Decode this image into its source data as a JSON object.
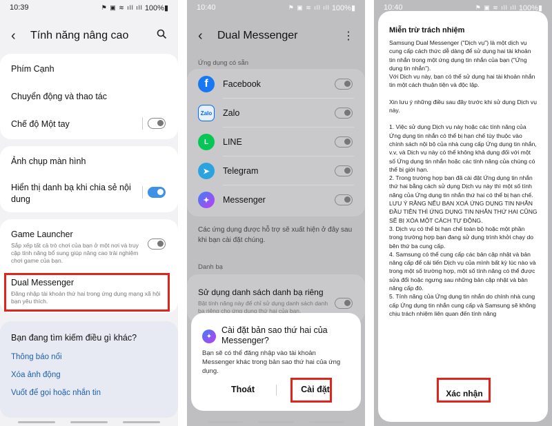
{
  "screen1": {
    "time": "10:39",
    "status_icons": "⚑ ▣ ≋ ıll ıll",
    "battery": "100%▮",
    "title": "Tính năng nâng cao",
    "items_card1": [
      "Phím Cạnh",
      "Chuyển động và thao tác",
      "Chế độ Một tay"
    ],
    "items_card2": [
      "Ảnh chụp màn hình",
      "Hiển thị danh bạ khi chia sẻ nội dung"
    ],
    "game_launcher": {
      "title": "Game Launcher",
      "sub": "Sắp xếp tất cả trò chơi của bạn ở một nơi và truy cập tính năng bổ sung giúp nâng cao trải nghiệm chơi game của bạn."
    },
    "dual_messenger": {
      "title": "Dual Messenger",
      "sub": "Đăng nhập tài khoản thứ hai trong ứng dụng mạng xã hội bạn yêu thích."
    },
    "search_prompt": "Bạn đang tìm kiếm điều gì khác?",
    "links": [
      "Thông báo nổi",
      "Xóa ảnh động",
      "Vuốt để gọi hoặc nhắn tin"
    ]
  },
  "screen2": {
    "time": "10:40",
    "status_icons": "⚑ ▣ ≋ ıll ıll",
    "battery": "100%▮",
    "title": "Dual Messenger",
    "section_available": "Ứng dụng có sẵn",
    "apps": [
      {
        "name": "Facebook",
        "icon": "f",
        "color": "#1877f2"
      },
      {
        "name": "Zalo",
        "icon": "Zalo",
        "color": "#0068ff"
      },
      {
        "name": "LINE",
        "icon": "L",
        "color": "#06c755"
      },
      {
        "name": "Telegram",
        "icon": "➤",
        "color": "#2aa3df"
      },
      {
        "name": "Messenger",
        "icon": "✦",
        "color": "#a23bec"
      }
    ],
    "note": "Các ứng dụng được hỗ trợ sẽ xuất hiện ở đây sau khi bạn cài đặt chúng.",
    "section_contacts": "Danh bạ",
    "contacts_title": "Sử dụng danh sách danh bạ riêng",
    "contacts_sub": "Bật tính năng này để chỉ sử dụng danh sách danh bạ riêng cho ứng dụng thứ hai của bạn.",
    "dialog": {
      "title": "Cài đặt bản sao thứ hai của Messenger?",
      "body": "Bạn sẽ có thể đăng nhập vào tài khoản Messenger khác trong bản sao thứ hai của ứng dụng.",
      "cancel": "Thoát",
      "confirm": "Cài đặt"
    }
  },
  "screen3": {
    "time": "10:40",
    "status_icons": "⚑ ▣ ≋ ıll ıll",
    "battery": "100%▮",
    "heading": "Miễn trừ trách nhiệm",
    "paragraphs": [
      "Samsung Dual Messenger (\"Dịch vụ\") là một dịch vụ cung cấp cách thức dễ dàng để sử dụng hai tài khoản tin nhắn trong một ứng dụng tin nhắn của bạn (\"Ứng dụng tin nhắn\").",
      "Với Dịch vụ này, bạn có thể sử dụng hai tài khoản nhắn tin một cách thuận tiện và độc lập.",
      "Xin lưu ý những điều sau đây trước khi sử dụng Dịch vụ này.",
      "1. Việc sử dụng Dịch vụ này hoặc các tính năng của Ứng dụng tin nhắn có thể bị hạn chế tùy thuộc vào chính sách nội bộ của nhà cung cấp Ứng dụng tin nhắn, v.v, và Dịch vụ này có thể không khả dụng đối với một số Ứng dụng tin nhắn hoặc các tính năng của chúng có thể bị giới hạn.",
      "2. Trong trường hợp bạn đã cài đặt Ứng dụng tin nhắn thứ hai bằng cách sử dụng Dịch vụ này thì một số tính năng của Ứng dụng tin nhắn thứ hai có thể bị hạn chế. LƯU Ý RẰNG NẾU BẠN XOÁ ỨNG DỤNG TIN NHẮN ĐẦU TIÊN THÌ ỨNG DỤNG TIN NHẮN THỨ HAI CŨNG SẼ BỊ XÓA MỘT CÁCH TỰ ĐỘNG.",
      "3. Dịch vụ có thể bị hạn chế toàn bộ hoặc một phần trong trường hợp bạn đang sử dụng trình khởi chạy do bên thứ ba cung cấp.",
      "4. Samsung có thể cung cấp các bản cập nhật và bản nâng cấp để cải tiến Dịch vụ của mình bất kỳ lúc nào và trong một số trường hợp, một số tính năng có thể được sửa đổi hoặc ngưng sau những bản cập nhật và bản nâng cấp đó.",
      "5. Tính năng của Ứng dụng tin nhắn do chính nhà cung cấp Ứng dụng tin nhắn cung cấp và Samsung sẽ không chịu trách nhiệm liên quan đến tính năng"
    ],
    "confirm": "Xác nhận"
  }
}
